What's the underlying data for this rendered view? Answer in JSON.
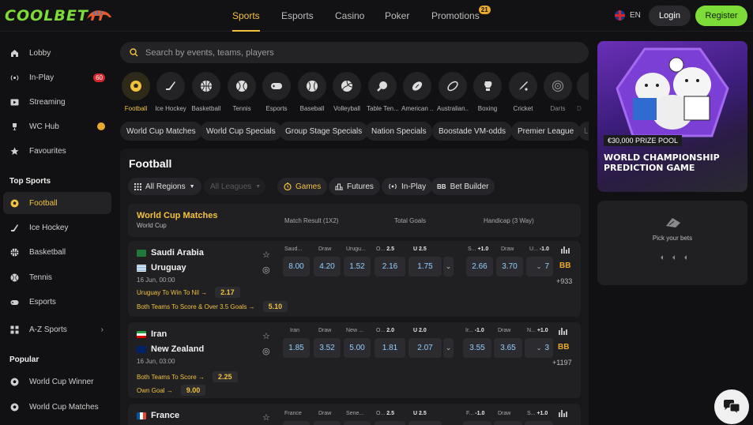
{
  "header": {
    "logo": "COOLBET",
    "nav": [
      {
        "label": "Sports"
      },
      {
        "label": "Esports"
      },
      {
        "label": "Casino"
      },
      {
        "label": "Poker"
      },
      {
        "label": "Promotions",
        "badge": "21"
      }
    ],
    "lang": "EN",
    "login": "Login",
    "register": "Register"
  },
  "sidebar": {
    "items": [
      {
        "label": "Lobby",
        "icon": "home-icon"
      },
      {
        "label": "In-Play",
        "icon": "live-icon",
        "badge": "60"
      },
      {
        "label": "Streaming",
        "icon": "play-icon"
      },
      {
        "label": "WC Hub",
        "icon": "trophy-icon"
      },
      {
        "label": "Favourites",
        "icon": "star-icon"
      }
    ],
    "top_sports_heading": "Top Sports",
    "top_sports": [
      {
        "label": "Football",
        "icon": "football-icon"
      },
      {
        "label": "Ice Hockey",
        "icon": "ice-hockey-icon"
      },
      {
        "label": "Basketball",
        "icon": "basketball-icon"
      },
      {
        "label": "Tennis",
        "icon": "tennis-icon"
      },
      {
        "label": "Esports",
        "icon": "gamepad-icon"
      }
    ],
    "az": "A-Z Sports",
    "popular_heading": "Popular",
    "popular": [
      {
        "label": "World Cup Winner"
      },
      {
        "label": "World Cup Matches"
      }
    ]
  },
  "search": {
    "placeholder": "Search by events, teams, players"
  },
  "sports_row": [
    "Football",
    "Ice Hockey",
    "Basketball",
    "Tennis",
    "Esports",
    "Baseball",
    "Volleyball",
    "Table Ten...",
    "American ...",
    "Australian...",
    "Boxing",
    "Cricket",
    "Darts",
    "D"
  ],
  "chips": [
    "World Cup Matches",
    "World Cup Specials",
    "Group Stage Specials",
    "Nation Specials",
    "Boostade VM-odds",
    "Premier League",
    "La"
  ],
  "main": {
    "title": "Football",
    "filters": {
      "regions": "All Regions",
      "leagues": "All Leagues",
      "games": "Games",
      "futures": "Futures",
      "inplay": "In-Play",
      "bb_icon": "BB",
      "builder": "Bet Builder"
    },
    "section": {
      "title": "World Cup Matches",
      "subtitle": "World Cup",
      "col1": "Match Result (1X2)",
      "col2": "Total Goals",
      "col3": "Handicap (3 Way)"
    },
    "matches": [
      {
        "home": "Saudi Arabia",
        "away": "Uruguay",
        "date": "16 Jun, 00:00",
        "specials": [
          {
            "label": "Uruguay To Win To Nil →",
            "odd": "2.17"
          },
          {
            "label": "Both Teams To Score & Over 3.5 Goals →",
            "odd": "5.10"
          }
        ],
        "heads": [
          "Saud...",
          "Draw",
          "Urugu...",
          "O...",
          "2.5",
          "U",
          "2.5",
          "S...",
          "+1.0",
          "Draw",
          "U...",
          "-1.0"
        ],
        "odds": [
          "8.00",
          "4.20",
          "1.52",
          "2.16",
          "1.75",
          "2.66",
          "3.70",
          "7"
        ],
        "bb": "BB",
        "more": "+933"
      },
      {
        "home": "Iran",
        "away": "New Zealand",
        "date": "16 Jun, 03:00",
        "specials": [
          {
            "label": "Both Teams To Score →",
            "odd": "2.25"
          },
          {
            "label": "Own Goal →",
            "odd": "9.00"
          }
        ],
        "heads": [
          "Iran",
          "Draw",
          "New ...",
          "O...",
          "2.0",
          "U",
          "2.0",
          "Ir...",
          "-1.0",
          "Draw",
          "N...",
          "+1.0"
        ],
        "odds": [
          "1.85",
          "3.52",
          "5.00",
          "1.81",
          "2.07",
          "3.55",
          "3.65",
          "3"
        ],
        "bb": "BB",
        "more": "+1197"
      },
      {
        "home": "France",
        "away": "",
        "date": "",
        "specials": [],
        "heads": [
          "France",
          "Draw",
          "Sene...",
          "O...",
          "2.5",
          "U",
          "2.5",
          "F...",
          "-1.0",
          "Draw",
          "S...",
          "+1.0"
        ],
        "odds": [],
        "bb": "",
        "more": ""
      }
    ]
  },
  "promo": {
    "badge": "€30,000 PRIZE POOL",
    "title_line1": "WORLD CHAMPIONSHIP",
    "title_line2": "PREDICTION GAME"
  },
  "betslip": {
    "label": "Pick your bets"
  }
}
